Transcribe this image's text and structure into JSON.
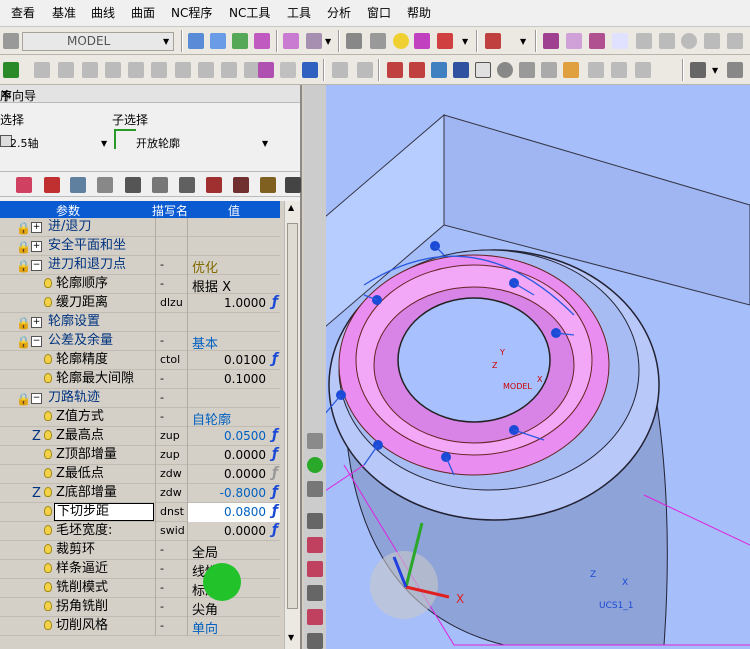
{
  "menu": [
    "查看",
    "基准",
    "曲线",
    "曲面",
    "NC程序",
    "NC工具",
    "工具",
    "分析",
    "窗口",
    "帮助"
  ],
  "toolbar": {
    "model_combo": "MODEL"
  },
  "panel": {
    "title": "序向导",
    "pin": "ㄗ",
    "close": "✕",
    "select_label": "选择",
    "select_value": "2.5轴",
    "subselect_label": "子选择",
    "subselect_value": "开放轮廓"
  },
  "grid": {
    "headers": [
      "参数",
      "描写名",
      "值"
    ],
    "rows": [
      {
        "label": "进/退刀",
        "code": "",
        "value": "",
        "kind": "group"
      },
      {
        "label": "安全平面和坐",
        "code": "",
        "value": "",
        "kind": "group"
      },
      {
        "label": "进刀和退刀点",
        "code": "-",
        "value": "优化",
        "kind": "group-open"
      },
      {
        "label": "轮廓顺序",
        "code": "-",
        "value": "根据 X",
        "kind": "item"
      },
      {
        "label": "缓刀距离",
        "code": "dlzu",
        "value": "1.0000",
        "kind": "item",
        "f": "ƒ"
      },
      {
        "label": "轮廓设置",
        "code": "",
        "value": "",
        "kind": "group"
      },
      {
        "label": "公差及余量",
        "code": "-",
        "value": "基本",
        "kind": "group-open"
      },
      {
        "label": "轮廓精度",
        "code": "ctol",
        "value": "0.0100",
        "kind": "item",
        "f": "ƒ"
      },
      {
        "label": "轮廓最大间隙",
        "code": "-",
        "value": "0.1000",
        "kind": "item"
      },
      {
        "label": "刀路轨迹",
        "code": "-",
        "value": "",
        "kind": "group-open"
      },
      {
        "label": "Z值方式",
        "code": "-",
        "value": "自轮廓",
        "kind": "item"
      },
      {
        "label": "Z最高点",
        "code": "zup",
        "value": "0.0500",
        "kind": "zitem",
        "f": "ƒ",
        "zprefix": "Z"
      },
      {
        "label": "Z顶部增量",
        "code": "zup",
        "value": "0.0000",
        "kind": "item",
        "f": "ƒ"
      },
      {
        "label": "Z最低点",
        "code": "zdw",
        "value": "0.0000",
        "kind": "item",
        "f": "ƒ"
      },
      {
        "label": "Z底部增量",
        "code": "zdw",
        "value": "-0.8000",
        "kind": "zitem",
        "f": "ƒ",
        "zprefix": "Z"
      },
      {
        "label": "下切步距",
        "code": "dnst",
        "value": "0.0800",
        "kind": "item",
        "f": "ƒ"
      },
      {
        "label": "毛坯宽度:",
        "code": "swid",
        "value": "0.0000",
        "kind": "item",
        "f": "ƒ"
      },
      {
        "label": "裁剪环",
        "code": "-",
        "value": "全局",
        "kind": "item"
      },
      {
        "label": "样条逼近",
        "code": "-",
        "value": "线性",
        "kind": "item"
      },
      {
        "label": "铣削模式",
        "code": "-",
        "value": "标准",
        "kind": "item"
      },
      {
        "label": "拐角铣削",
        "code": "-",
        "value": "尖角",
        "kind": "item"
      },
      {
        "label": "切削风格",
        "code": "-",
        "value": "单向",
        "kind": "item"
      }
    ]
  },
  "viewport": {
    "model_label": "MODEL",
    "ucs_label": "UCS1_1",
    "axis_x": "X",
    "axis_y": "Y",
    "axis_z": "Z"
  },
  "colors": {
    "header_blue": "#0a5ad2",
    "part_blue": "#a9c0ff",
    "pink": "#e98ef0",
    "value_blue": "#0060c0"
  }
}
